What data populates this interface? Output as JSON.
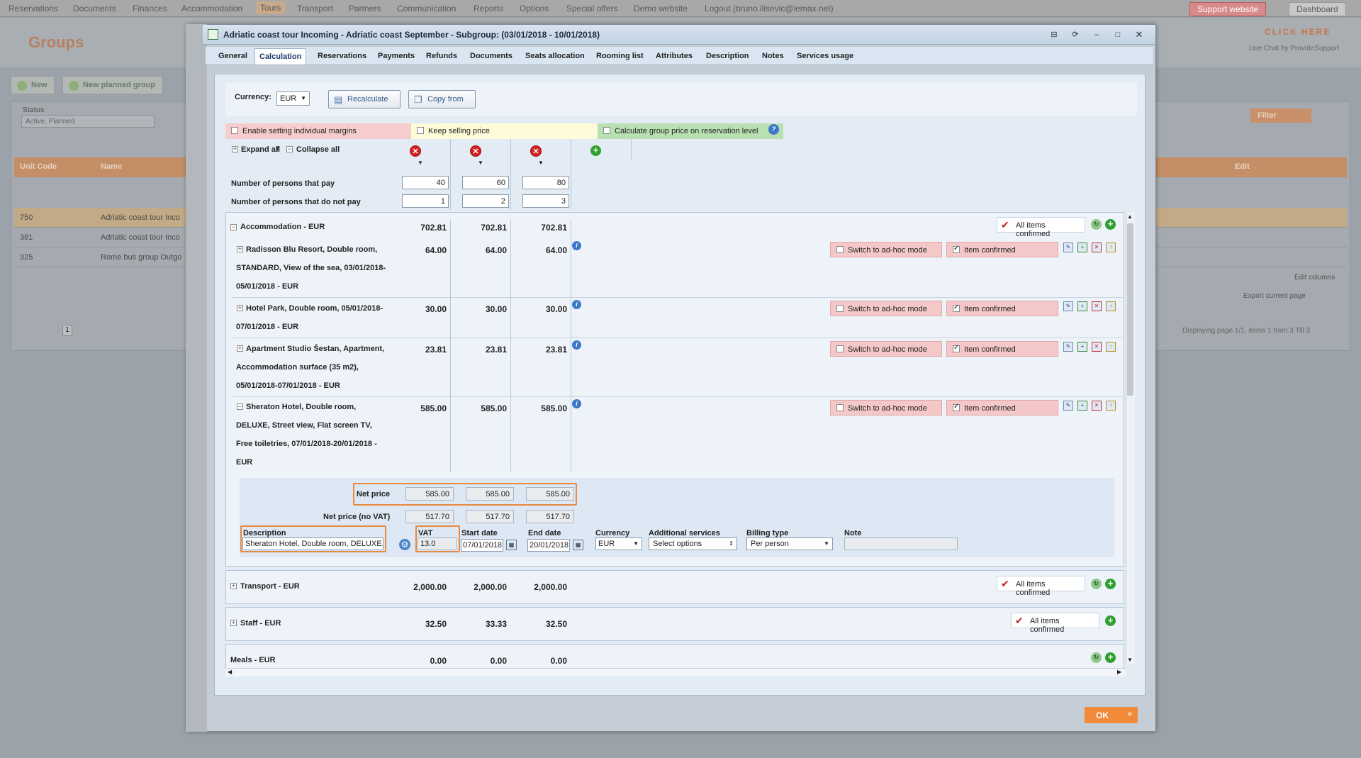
{
  "app": {
    "nav": [
      "Reservations",
      "Documents",
      "Finances",
      "Accommodation",
      "Tours",
      "Transport",
      "Partners",
      "Communication",
      "Reports",
      "Options",
      "Special offers",
      "Demo website",
      "Logout (bruno.ilisevic@lemax.net)"
    ],
    "support_label": "Support website",
    "dashboard_label": "Dashboard",
    "page_title": "Groups",
    "new_label": "New",
    "new_planned_label": "New planned group",
    "status_label": "Status",
    "status_value": "Active, Planned",
    "filter_label": "Filter",
    "click_here": "CLICK HERE",
    "livechat": "Live Chat by ProvideSupport",
    "col_unit_code": "Unit Code",
    "col_name": "Name",
    "col_edit": "Edit",
    "rows": [
      {
        "code": "750",
        "name": "Adriatic coast tour Inco"
      },
      {
        "code": "381",
        "name": "Adriatic coast tour Inco"
      },
      {
        "code": "325",
        "name": "Rome bus group Outgo"
      }
    ],
    "edit_columns": "Edit columns",
    "export_label": "Export current page",
    "page_num": "1",
    "paging_info": "Displaying page 1/1, items 1 from 3 Till 3"
  },
  "modal": {
    "title": "Adriatic coast tour Incoming - Adriatic coast September - Subgroup: (03/01/2018 - 10/01/2018)",
    "tabs": [
      "General",
      "Calculation",
      "Reservations",
      "Payments",
      "Refunds",
      "Documents",
      "Seats allocation",
      "Rooming list",
      "Attributes",
      "Description",
      "Notes",
      "Services usage"
    ],
    "currency_label": "Currency:",
    "currency_value": "EUR",
    "recalculate_label": "Recalculate",
    "copy_from_label": "Copy from",
    "enable_margins_label": "Enable setting individual margins",
    "keep_selling_label": "Keep selling price",
    "calc_group_label": "Calculate group price on reservation level",
    "expand_all": "Expand all",
    "collapse_all": "Collapse all",
    "persons_pay_label": "Number of persons that pay",
    "persons_pay": [
      "40",
      "60",
      "80"
    ],
    "persons_not_pay_label": "Number of persons that do not pay",
    "persons_not_pay": [
      "1",
      "2",
      "3"
    ],
    "accommodation": {
      "label": "Accommodation - EUR",
      "totals": [
        "702.81",
        "702.81",
        "702.81"
      ],
      "all_confirmed": "All items confirmed",
      "items": [
        {
          "lines": [
            "Radisson Blu Resort, Double room,",
            "STANDARD, View of the sea, 03/01/2018-",
            "05/01/2018 - EUR"
          ],
          "values": [
            "64.00",
            "64.00",
            "64.00"
          ]
        },
        {
          "lines": [
            "Hotel Park, Double room, 05/01/2018-",
            "07/01/2018 - EUR"
          ],
          "values": [
            "30.00",
            "30.00",
            "30.00"
          ]
        },
        {
          "lines": [
            "Apartment Studio Šestan, Apartment,",
            "Accommodation surface (35 m2),",
            "05/01/2018-07/01/2018 - EUR"
          ],
          "values": [
            "23.81",
            "23.81",
            "23.81"
          ]
        },
        {
          "lines": [
            "Sheraton Hotel, Double room,",
            "DELUXE, Street view, Flat screen TV,",
            "Free toiletries, 07/01/2018-20/01/2018 -",
            "EUR"
          ],
          "values": [
            "585.00",
            "585.00",
            "585.00"
          ]
        }
      ],
      "switch_label": "Switch to ad-hoc mode",
      "item_confirmed_label": "Item confirmed"
    },
    "detail": {
      "net_price_label": "Net price",
      "net_price": [
        "585.00",
        "585.00",
        "585.00"
      ],
      "net_novat_label": "Net price (no VAT)",
      "net_novat": [
        "517.70",
        "517.70",
        "517.70"
      ],
      "description_label": "Description",
      "description_value": "Sheraton Hotel, Double room, DELUXE,",
      "vat_label": "VAT",
      "vat_value": "13.0",
      "start_label": "Start date",
      "start_value": "07/01/2018",
      "end_label": "End date",
      "end_value": "20/01/2018",
      "currency_label": "Currency",
      "currency_value": "EUR",
      "additional_label": "Additional services",
      "additional_value": "Select options",
      "billing_label": "Billing type",
      "billing_value": "Per person",
      "note_label": "Note"
    },
    "transport": {
      "label": "Transport - EUR",
      "totals": [
        "2,000.00",
        "2,000.00",
        "2,000.00"
      ],
      "all_confirmed": "All items confirmed"
    },
    "staff": {
      "label": "Staff - EUR",
      "totals": [
        "32.50",
        "33.33",
        "32.50"
      ],
      "all_confirmed": "All items confirmed"
    },
    "meals": {
      "label": "Meals - EUR",
      "totals": [
        "0.00",
        "0.00",
        "0.00"
      ]
    },
    "ok_label": "OK"
  }
}
